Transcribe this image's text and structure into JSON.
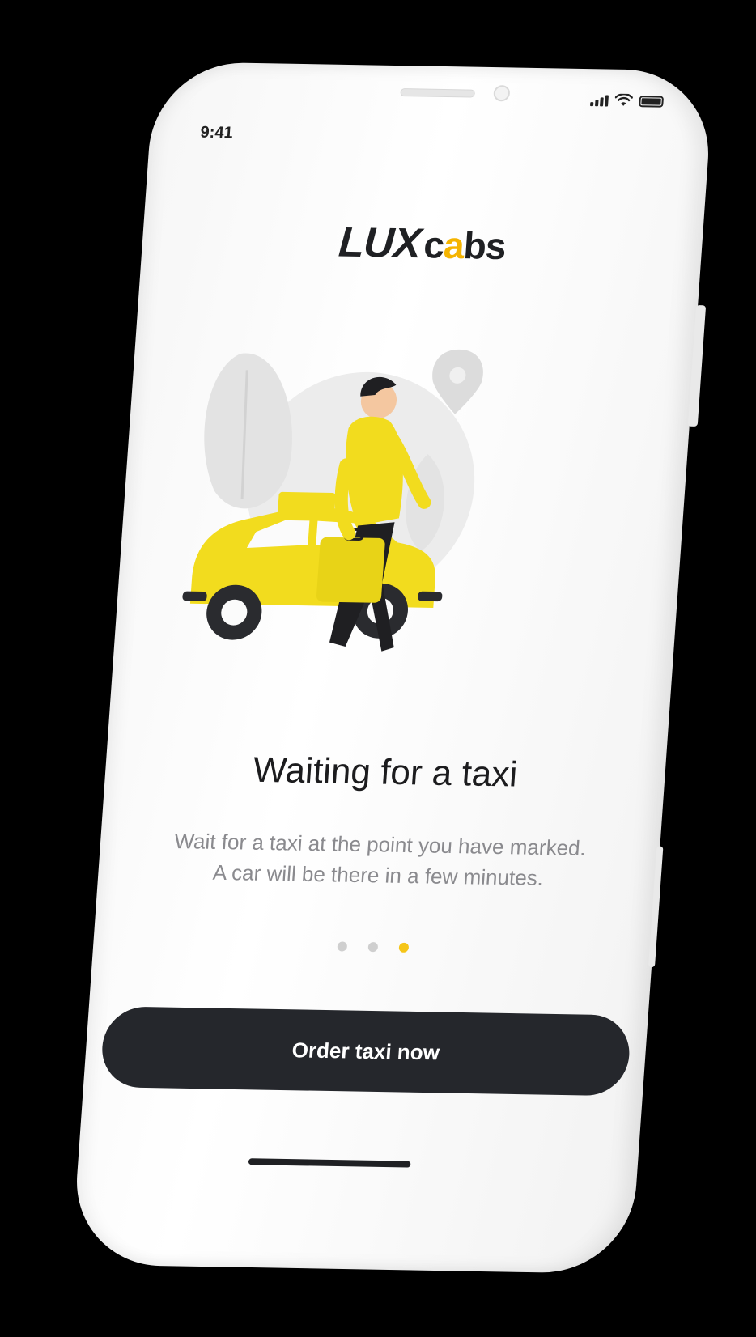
{
  "status_bar": {
    "time": "9:41",
    "signal_icon": "cellular-signal-icon",
    "wifi_icon": "wifi-icon",
    "battery_icon": "battery-icon"
  },
  "logo": {
    "part1": "LUX",
    "part2_c": "c",
    "part2_a": "a",
    "part2_bs": "bs"
  },
  "onboarding": {
    "title": "Waiting for a taxi",
    "description_line1": "Wait for a taxi at the point you have marked.",
    "description_line2": "A car will be there in a few minutes.",
    "page_indicator": {
      "total": 3,
      "active": 3
    }
  },
  "cta": {
    "label": "Order taxi now"
  },
  "colors": {
    "accent": "#f5c518",
    "dark": "#25272c",
    "text_secondary": "#8a8a8e"
  }
}
